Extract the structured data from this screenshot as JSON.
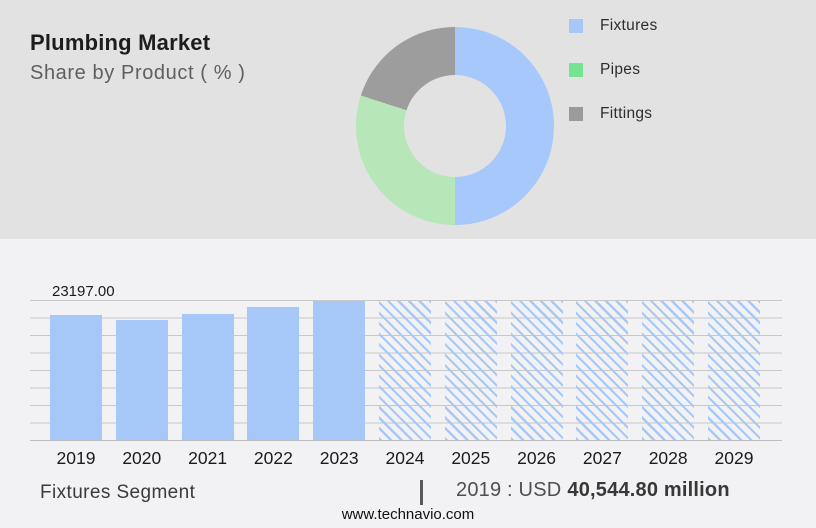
{
  "colors": {
    "top_background": "#e2e2e2",
    "bottom_background": "#f2f2f4",
    "gridline": "#c8c8c8",
    "bar_solid": "#a6c8f8",
    "bar_hatch": "#a8c8f5"
  },
  "header": {
    "title": "Plumbing Market",
    "subtitle": "Share by Product ( % )"
  },
  "chart_data": [
    {
      "type": "pie",
      "donut": true,
      "title": "Share by Product ( % )",
      "labels": [
        "Fixtures",
        "Pipes",
        "Fittings"
      ],
      "values": [
        50,
        30,
        20
      ],
      "colors": [
        "#a7c8fa",
        "#b7e6b8",
        "#9d9d9d"
      ],
      "legend_colors": [
        "#a5c7fa",
        "#74e392",
        "#9b9b9b"
      ],
      "legend_position": "right",
      "start_angle_deg": 0,
      "direction": "clockwise"
    },
    {
      "type": "bar",
      "categories": [
        "2019",
        "2020",
        "2021",
        "2022",
        "2023",
        "2024",
        "2025",
        "2026",
        "2027",
        "2028",
        "2029"
      ],
      "values": [
        23197,
        22270,
        23440,
        24690,
        25890,
        25800,
        25800,
        25800,
        25800,
        25800,
        25800
      ],
      "bar_label": {
        "category": "2019",
        "text": "23197.00"
      },
      "forecast_start_index": 5,
      "forecast_style": "hatched",
      "ylim": [
        0,
        26000
      ],
      "grid": true,
      "gridline_count": 9,
      "xlabel": "",
      "ylabel": ""
    }
  ],
  "footer": {
    "segment_label": "Fixtures Segment",
    "separator": "|",
    "value_prefix": "2019 : USD",
    "value_bold": "40,544.80 million",
    "website": "www.technavio.com"
  }
}
